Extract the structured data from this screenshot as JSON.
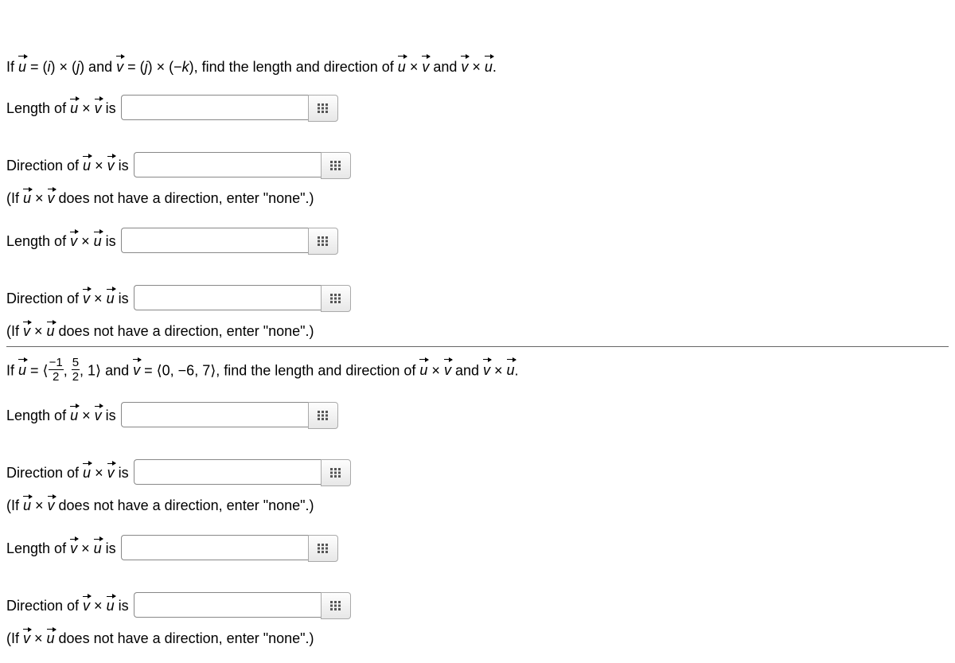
{
  "problem1": {
    "prompt_html": "If <span class='vec'>u</span> = (<span class='ital'>i</span>) × (<span class='ital'>j</span>) and <span class='vec'>v</span> = (<span class='ital'>j</span>) × (−<span class='ital'>k</span>), find the length and direction of <span class='vec'>u</span> × <span class='vec'>v</span> and <span class='vec'>v</span> × <span class='vec'>u</span>.",
    "length_uv_label": "Length of <span class='vec'>u</span> × <span class='vec'>v</span> is",
    "direction_uv_label": "Direction of <span class='vec'>u</span> × <span class='vec'>v</span> is",
    "hint_uv": "(If <span class='vec'>u</span> × <span class='vec'>v</span> does not have a direction, enter \"none\".)",
    "length_vu_label": "Length of <span class='vec'>v</span> × <span class='vec'>u</span> is",
    "direction_vu_label": "Direction of <span class='vec'>v</span> × <span class='vec'>u</span> is",
    "hint_vu": "(If <span class='vec'>v</span> × <span class='vec'>u</span> does not have a direction, enter \"none\".)"
  },
  "problem2": {
    "prompt_html": "If <span class='vec'>u</span> = ⟨<span class='frac'><span class='num'>−1</span><span class='den'>2</span></span>, <span class='frac'><span class='num'>5</span><span class='den'>2</span></span>, 1⟩ and <span class='vec'>v</span> = ⟨0, −6, 7⟩, find the length and direction of <span class='vec'>u</span> × <span class='vec'>v</span> and <span class='vec'>v</span> × <span class='vec'>u</span>.",
    "length_uv_label": "Length of <span class='vec'>u</span> × <span class='vec'>v</span> is",
    "direction_uv_label": "Direction of <span class='vec'>u</span> × <span class='vec'>v</span> is",
    "hint_uv": "(If <span class='vec'>u</span> × <span class='vec'>v</span> does not have a direction, enter \"none\".)",
    "length_vu_label": "Length of <span class='vec'>v</span> × <span class='vec'>u</span> is",
    "direction_vu_label": "Direction of <span class='vec'>v</span> × <span class='vec'>u</span> is",
    "hint_vu": "(If <span class='vec'>v</span> × <span class='vec'>u</span> does not have a direction, enter \"none\".)"
  },
  "icons": {
    "equation_editor": "equation-editor-icon"
  }
}
